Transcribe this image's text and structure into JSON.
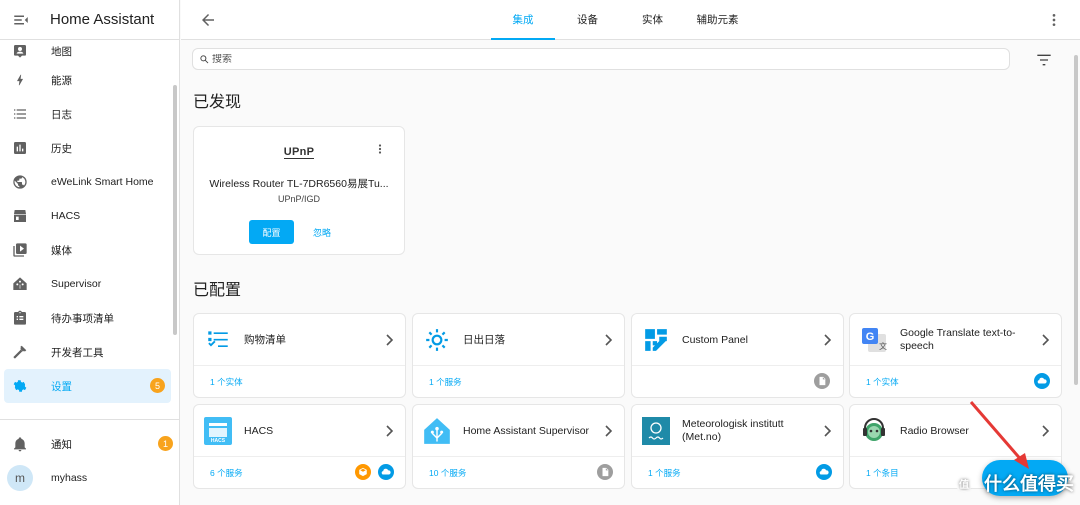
{
  "app": {
    "title": "Home Assistant"
  },
  "sidebar": {
    "items": [
      {
        "label": "地图",
        "icon": "map-icon"
      },
      {
        "label": "能源",
        "icon": "lightning-icon"
      },
      {
        "label": "日志",
        "icon": "list-icon"
      },
      {
        "label": "历史",
        "icon": "chart-icon"
      },
      {
        "label": "eWeLink Smart Home",
        "icon": "globe-icon"
      },
      {
        "label": "HACS",
        "icon": "hacs-icon"
      },
      {
        "label": "媒体",
        "icon": "media-icon"
      },
      {
        "label": "Supervisor",
        "icon": "home-assistant-icon"
      },
      {
        "label": "待办事项清单",
        "icon": "clipboard-icon"
      },
      {
        "label": "开发者工具",
        "icon": "hammer-icon"
      },
      {
        "label": "设置",
        "icon": "gear-icon",
        "badge": "5"
      }
    ],
    "notifications": {
      "label": "通知",
      "badge": "1"
    },
    "user": {
      "label": "myhass",
      "initial": "m"
    }
  },
  "topbar": {
    "tabs": [
      {
        "label": "集成",
        "active": true
      },
      {
        "label": "设备"
      },
      {
        "label": "实体"
      },
      {
        "label": "辅助元素"
      }
    ]
  },
  "search": {
    "placeholder": "搜索"
  },
  "discovered": {
    "title": "已发现",
    "card": {
      "logo": "UPnP",
      "name": "Wireless Router TL-7DR6560易展Tu...",
      "subtitle": "UPnP/IGD",
      "configure_label": "配置",
      "ignore_label": "忽略"
    }
  },
  "configured": {
    "title": "已配置",
    "cards": [
      {
        "name": "购物清单",
        "link": "1 个实体",
        "icon": "shopping-list-icon"
      },
      {
        "name": "日出日落",
        "link": "1 个服务",
        "icon": "sun-icon"
      },
      {
        "name": "Custom Panel",
        "link": "",
        "icon": "custom-panel-icon",
        "badges": [
          "doc"
        ]
      },
      {
        "name": "Google Translate text-to-speech",
        "link": "1 个实体",
        "icon": "google-translate-icon",
        "badges": [
          "cloud"
        ]
      },
      {
        "name": "HACS",
        "link": "6 个服务",
        "icon": "hacs-logo-icon",
        "badges": [
          "hacs",
          "cloud"
        ]
      },
      {
        "name": "Home Assistant Supervisor",
        "link": "10 个服务",
        "icon": "home-assistant-logo-icon",
        "badges": [
          "doc"
        ]
      },
      {
        "name": "Meteorologisk institutt (Met.no)",
        "link": "1 个服务",
        "icon": "met-no-icon",
        "badges": [
          "cloud"
        ]
      },
      {
        "name": "Radio Browser",
        "link": "1 个条目",
        "icon": "radio-browser-icon"
      }
    ]
  },
  "watermark": "什么值得买",
  "colors": {
    "accent": "#03a9f4",
    "badge": "#f8a31d",
    "arrow": "#e53935"
  }
}
